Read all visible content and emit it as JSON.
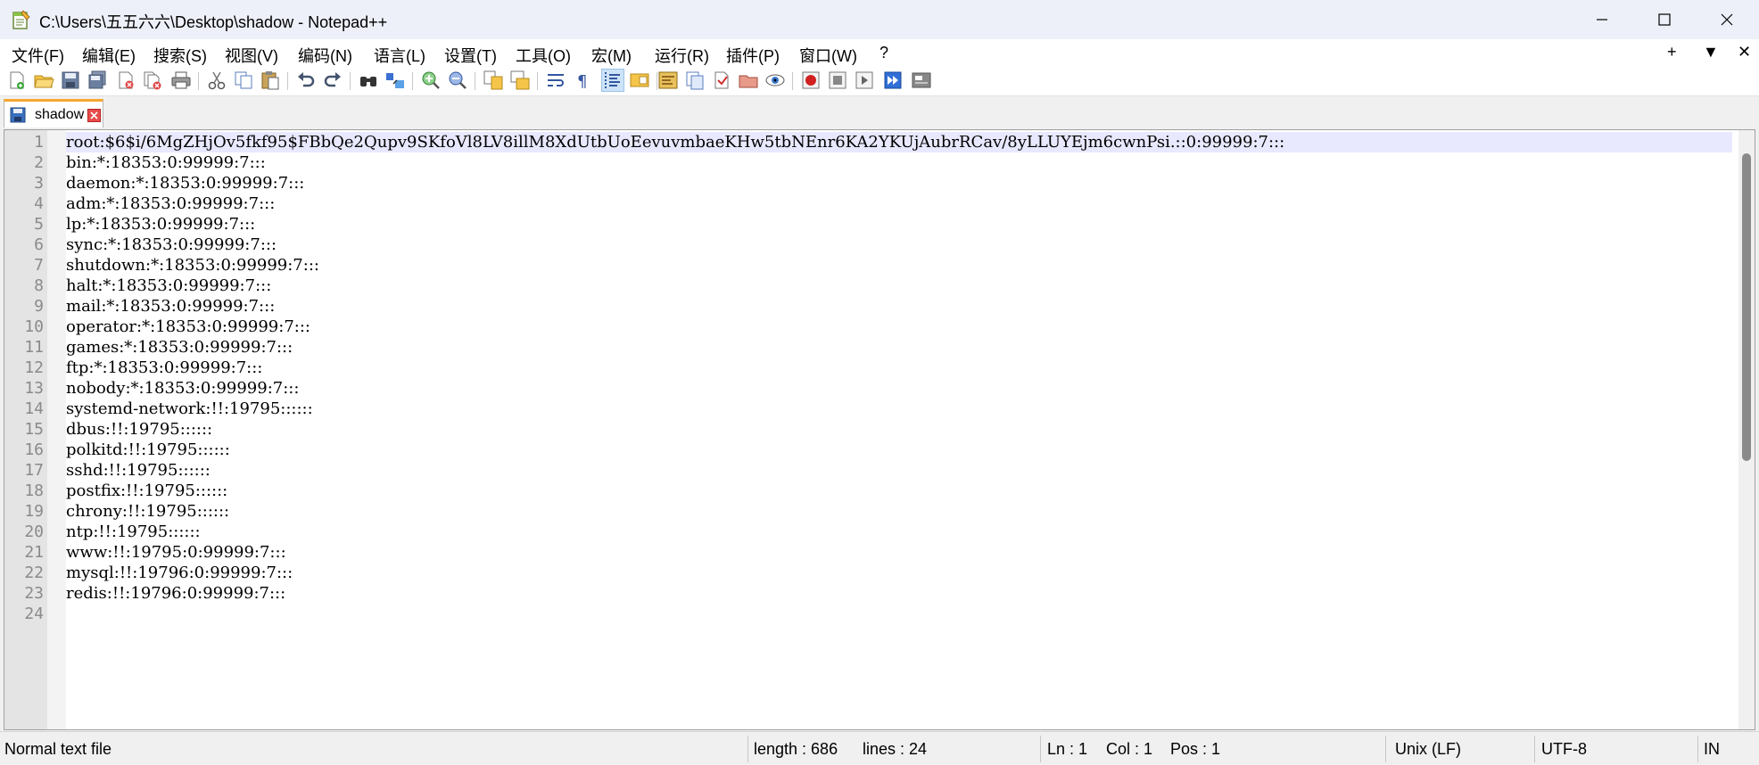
{
  "window": {
    "title": "C:\\Users\\五五六六\\Desktop\\shadow - Notepad++",
    "minimize_icon": "minimize-icon",
    "maximize_icon": "maximize-icon",
    "close_icon": "close-icon"
  },
  "menu": {
    "items": [
      "文件(F)",
      "编辑(E)",
      "搜索(S)",
      "视图(V)",
      "编码(N)",
      "语言(L)",
      "设置(T)",
      "工具(O)",
      "宏(M)",
      "运行(R)",
      "插件(P)",
      "窗口(W)",
      "?"
    ],
    "right": [
      "+",
      "▼",
      "✕"
    ]
  },
  "toolbar": {
    "icons": [
      "new-file-icon",
      "open-file-icon",
      "save-icon",
      "save-all-icon",
      "close-icon",
      "close-all-icon",
      "print-icon",
      "cut-icon",
      "copy-icon",
      "paste-icon",
      "undo-icon",
      "redo-icon",
      "find-icon",
      "replace-icon",
      "zoom-in-icon",
      "zoom-out-icon",
      "sync-vertical-icon",
      "sync-horizontal-icon",
      "word-wrap-icon",
      "show-all-chars-icon",
      "indent-guide-icon",
      "document-map-icon",
      "function-list-icon",
      "folder-workspace-icon",
      "document-list-icon",
      "open-in-explorer-icon",
      "monitor-icon",
      "record-macro-icon",
      "stop-macro-icon",
      "play-macro-icon",
      "run-macro-multiple-icon",
      "save-macro-icon"
    ]
  },
  "tab": {
    "label": "shadow",
    "icon": "save-icon",
    "close_icon": "close-icon"
  },
  "editor": {
    "lines": [
      "root:$6$i/6MgZHjOv5fkf95$FBbQe2Qupv9SKfoVl8LV8illM8XdUtbUoEevuvmbaeKHw5tbNEnr6KA2YKUjAubrRCav/8yLLUYEjm6cwnPsi.::0:99999:7:::",
      "bin:*:18353:0:99999:7:::",
      "daemon:*:18353:0:99999:7:::",
      "adm:*:18353:0:99999:7:::",
      "lp:*:18353:0:99999:7:::",
      "sync:*:18353:0:99999:7:::",
      "shutdown:*:18353:0:99999:7:::",
      "halt:*:18353:0:99999:7:::",
      "mail:*:18353:0:99999:7:::",
      "operator:*:18353:0:99999:7:::",
      "games:*:18353:0:99999:7:::",
      "ftp:*:18353:0:99999:7:::",
      "nobody:*:18353:0:99999:7:::",
      "systemd-network:!!:19795::::::",
      "dbus:!!:19795::::::",
      "polkitd:!!:19795::::::",
      "sshd:!!:19795::::::",
      "postfix:!!:19795::::::",
      "chrony:!!:19795::::::",
      "ntp:!!:19795::::::",
      "www:!!:19795:0:99999:7:::",
      "mysql:!!:19796:0:99999:7:::",
      "redis:!!:19796:0:99999:7:::",
      ""
    ]
  },
  "status": {
    "file_type": "Normal text file",
    "length": "length : 686",
    "lines": "lines : 24",
    "ln": "Ln : 1",
    "col": "Col : 1",
    "pos": "Pos : 1",
    "eol": "Unix (LF)",
    "encoding": "UTF-8",
    "mode": "IN"
  },
  "colors": {
    "current_line": "#e8e8ff",
    "tab_accent": "#f6a72f",
    "gutter": "#e4e4e4"
  }
}
